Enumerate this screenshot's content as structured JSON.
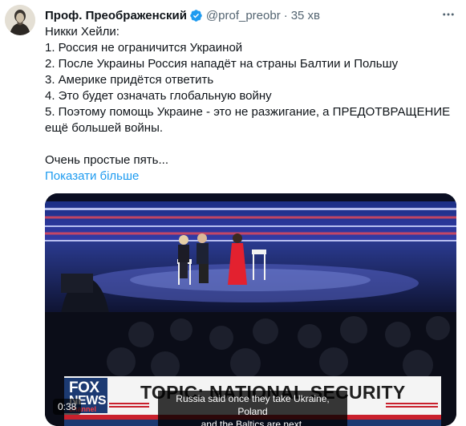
{
  "author": {
    "name": "Проф. Преображенский",
    "handle": "@prof_preobr",
    "separator": "·",
    "time": "35 хв"
  },
  "icons": {
    "avatar": "avatar-icon",
    "verified": "verified-badge-icon",
    "more": "more-options-icon"
  },
  "colors": {
    "link": "#1d9bf0",
    "verified": "#1d9bf0",
    "secondary_text": "#536471"
  },
  "tweet": {
    "lines": [
      "Никки Хейли:",
      "1. Россия не ограничится Украиной",
      "2. После Украины Россия нападёт на страны Балтии и Польшу",
      "3. Америке придётся ответить",
      "4. Это будет означать глобальную войну",
      "5. Поэтому помощь Украине - это не разжигание, а ПРЕДОТВРАЩЕНИЕ",
      "ещё большей войны.",
      "Очень простые пять..."
    ],
    "show_more": "Показати більше"
  },
  "video": {
    "banner_text": "TOPIC: NATIONAL SECURITY",
    "logo_line1": "FOX",
    "logo_line2": "NEWS",
    "logo_line3": "channel",
    "caption_line1": "Russia said once they take Ukraine, Poland",
    "caption_line2": "and the Baltics are next.",
    "timestamp": "0:38"
  }
}
